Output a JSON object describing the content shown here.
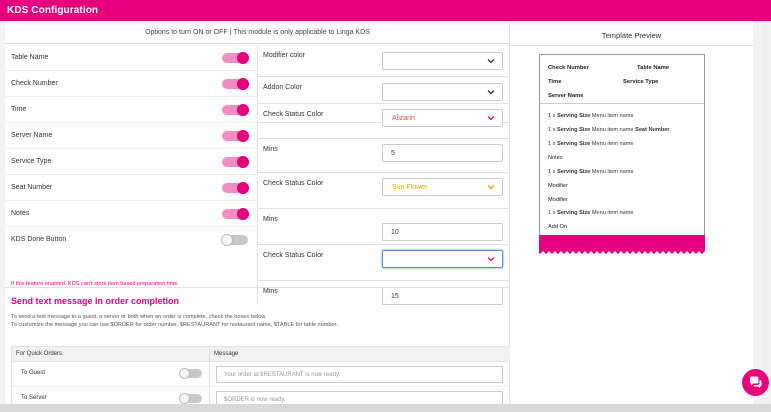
{
  "header": {
    "title": "KDS Configuration"
  },
  "notice": {
    "text": "Options to turn ON or OFF",
    "sep": " | ",
    "highlight": "This module is only applicable to Linga KDS"
  },
  "toggles": [
    {
      "label": "Table Name",
      "on": true
    },
    {
      "label": "Check Number",
      "on": true
    },
    {
      "label": "Time",
      "on": true
    },
    {
      "label": "Server Name",
      "on": true
    },
    {
      "label": "Service Type",
      "on": true
    },
    {
      "label": "Seat Number",
      "on": true
    },
    {
      "label": "Notes",
      "on": true
    },
    {
      "label": "KDS Done Button",
      "on": false
    }
  ],
  "warning": "If this feature enabled, KDS can't store item based preparation time",
  "settings": [
    {
      "label": "Modifier color",
      "type": "select",
      "value": "",
      "color": ""
    },
    {
      "label": "Addon Color",
      "type": "select",
      "value": "",
      "color": ""
    },
    {
      "label": "Check Status Color",
      "type": "select",
      "value": "Alizarin",
      "color": "#e74c3c"
    },
    {
      "label": "Mins",
      "type": "input",
      "value": "5"
    },
    {
      "label": "Check Status Color",
      "type": "select",
      "value": "Sun Flower",
      "color": "#e5a400"
    },
    {
      "label": "Mins",
      "type": "input",
      "value": "10"
    },
    {
      "label": "Check Status Color",
      "type": "select",
      "value": "",
      "color": ""
    },
    {
      "label": "Mins",
      "type": "input",
      "value": "15"
    }
  ],
  "sms": {
    "title": "Send text message in order completion",
    "desc1": "To send a text message to a guest, a server or both when an order is complete, check the boxes below.",
    "desc2": "To customize the message you can use $ORDER for order number, $RESTAURANT for restaurant name, $TABLE for table number.",
    "col1": "For Quick Orders",
    "col2": "Message",
    "rows": [
      {
        "label": "To Guest",
        "message": "Your order at $RESTAURANT is now ready.",
        "on": false
      },
      {
        "label": "To Server",
        "message": "$ORDER is now ready.",
        "on": false
      }
    ]
  },
  "preview": {
    "title": "Template Preview",
    "check_number": "Check Number",
    "table_name": "Table Name",
    "time": "Time",
    "service_type": "Service Type",
    "server_name": "Server Name",
    "qty": "1 x",
    "serving_size": "Serving Size",
    "item_name": "Menu item name",
    "seat_number": "Seat Number",
    "notes": "Notes",
    "modifier": "Modifier",
    "add_on": "Add On"
  },
  "colors": {
    "brand": "#e6007e"
  },
  "icons": {
    "chat": "chat-bubble-icon",
    "chevron": "chevron-down-icon"
  }
}
